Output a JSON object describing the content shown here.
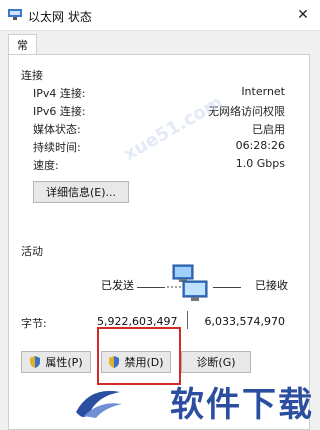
{
  "window": {
    "title": "以太网 状态",
    "close": "✕"
  },
  "tabs": [
    {
      "label": "常规"
    }
  ],
  "connection": {
    "title": "连接",
    "rows": [
      {
        "label": "IPv4 连接:",
        "value": "Internet"
      },
      {
        "label": "IPv6 连接:",
        "value": "无网络访问权限"
      },
      {
        "label": "媒体状态:",
        "value": "已启用"
      },
      {
        "label": "持续时间:",
        "value": "06:28:26"
      },
      {
        "label": "速度:",
        "value": "1.0 Gbps"
      }
    ],
    "details_button": "详细信息(E)..."
  },
  "activity": {
    "title": "活动",
    "sent_label": "已发送",
    "received_label": "已接收",
    "bytes_label": "字节:",
    "bytes_sent": "5,922,603,497",
    "bytes_received": "6,033,574,970"
  },
  "buttons": {
    "properties": "属性(P)",
    "disable": "禁用(D)",
    "diagnose": "诊断(G)"
  },
  "watermark": {
    "brand": "软件下载",
    "text": "xue51.com"
  },
  "colors": {
    "accent": "#2c4ea0",
    "highlight": "#d32a2a"
  }
}
